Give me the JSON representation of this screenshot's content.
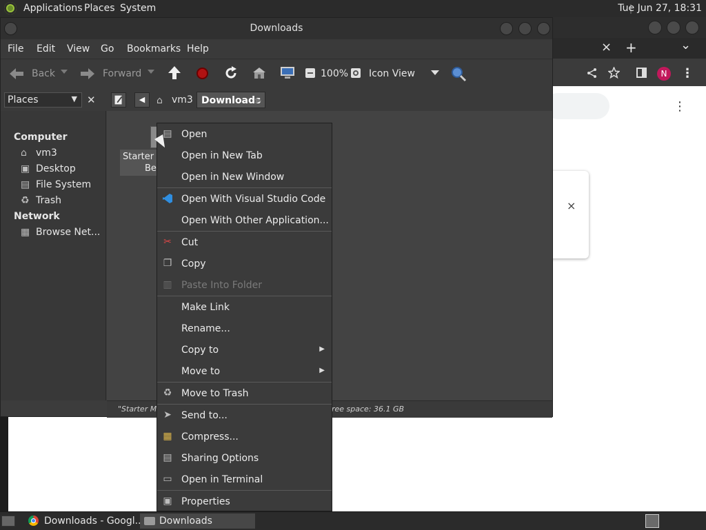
{
  "top_panel": {
    "menus": [
      "Applications",
      "Places",
      "System"
    ],
    "clock": "Tue Jun 27, 18:31"
  },
  "chrome_window": {
    "tab_close": "×",
    "new_tab": "+",
    "tab_list": "⌄",
    "avatar_initial": "N",
    "kebab": "⋮",
    "card_close": "×"
  },
  "file_manager": {
    "title": "Downloads",
    "menubar": [
      "File",
      "Edit",
      "View",
      "Go",
      "Bookmarks",
      "Help"
    ],
    "toolbar": {
      "back": "Back",
      "forward": "Forward",
      "zoom": "100%",
      "view_mode": "Icon View"
    },
    "location": {
      "side_pane_mode": "Places",
      "path": [
        "vm3",
        "Downloads"
      ]
    },
    "sidebar": {
      "sections": [
        {
          "heading": "Computer",
          "items": [
            "vm3",
            "Desktop",
            "File System",
            "Trash"
          ]
        },
        {
          "heading": "Network",
          "items": [
            "Browse Net..."
          ]
        }
      ]
    },
    "file": {
      "label_line1": "Starter M",
      "label_line2": "Be"
    },
    "status": {
      "left": "\"Starter Mo",
      "right": "ree space: 36.1 GB"
    }
  },
  "context_menu": {
    "groups": [
      [
        {
          "label": "Open",
          "icon": "open-icon"
        },
        {
          "label": "Open in New Tab"
        },
        {
          "label": "Open in New Window"
        }
      ],
      [
        {
          "label": "Open With Visual Studio Code",
          "icon": "vscode-icon"
        },
        {
          "label": "Open With Other Application..."
        }
      ],
      [
        {
          "label": "Cut",
          "icon": "scissors-icon"
        },
        {
          "label": "Copy",
          "icon": "copy-icon"
        },
        {
          "label": "Paste Into Folder",
          "icon": "paste-icon",
          "disabled": true
        }
      ],
      [
        {
          "label": "Make Link"
        },
        {
          "label": "Rename..."
        },
        {
          "label": "Copy to",
          "submenu": true
        },
        {
          "label": "Move to",
          "submenu": true
        }
      ],
      [
        {
          "label": "Move to Trash",
          "icon": "trash-icon"
        }
      ],
      [
        {
          "label": "Send to...",
          "icon": "send-icon"
        },
        {
          "label": "Compress...",
          "icon": "archive-icon"
        },
        {
          "label": "Sharing Options",
          "icon": "share-folder-icon"
        },
        {
          "label": "Open in Terminal",
          "icon": "terminal-icon"
        }
      ],
      [
        {
          "label": "Properties",
          "icon": "properties-icon"
        }
      ]
    ]
  },
  "taskbar": {
    "tasks": [
      "Downloads - Googl...",
      "Downloads"
    ]
  },
  "colors": {
    "panel": "#2b2b2b",
    "window": "#3c3c3c",
    "menu": "#3b3b3b",
    "stop": "#b01212",
    "avatar": "#c2185b"
  }
}
